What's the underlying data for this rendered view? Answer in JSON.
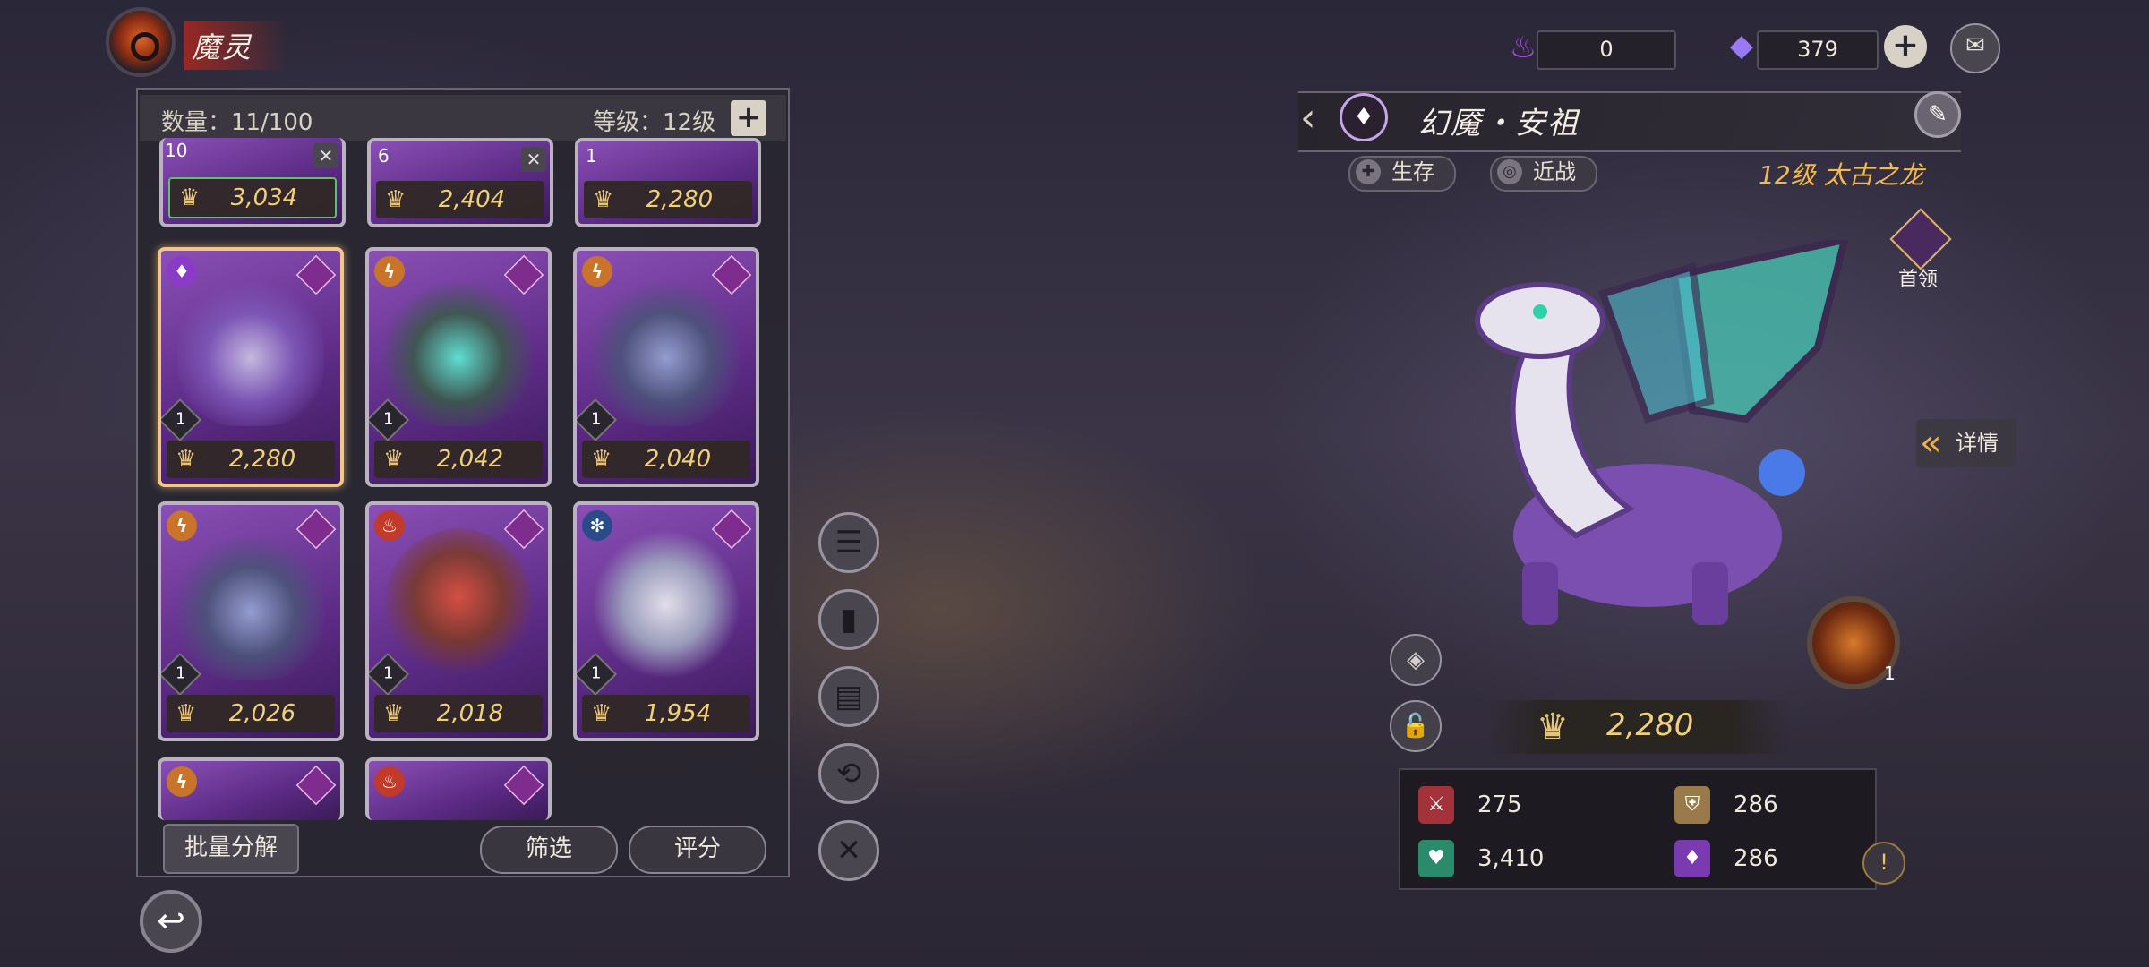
{
  "header": {
    "title": "魔灵"
  },
  "panel": {
    "count_label": "数量：11/100",
    "level_label": "等级：12级"
  },
  "cards_top": [
    {
      "level": "10",
      "power": "3,034",
      "has_crossed": true
    },
    {
      "level": "6",
      "power": "2,404",
      "has_crossed": true
    },
    {
      "level": "1",
      "power": "2,280",
      "has_crossed": false
    }
  ],
  "cards": [
    {
      "element": "water-drop",
      "level": "1",
      "power": "2,280",
      "selected": true,
      "color": "#9a7ad6"
    },
    {
      "element": "lightning",
      "level": "1",
      "power": "2,042",
      "color": "#4fd1c5"
    },
    {
      "element": "lightning",
      "level": "1",
      "power": "2,040",
      "color": "#6c7aa8"
    },
    {
      "element": "lightning",
      "level": "1",
      "power": "2,026",
      "color": "#6c7aa8"
    },
    {
      "element": "fire",
      "level": "1",
      "power": "2,018",
      "color": "#c2483a"
    },
    {
      "element": "snowflake",
      "level": "1",
      "power": "1,954",
      "color": "#d8dde8"
    }
  ],
  "bottom": {
    "batch_label": "批量分解",
    "filter_label": "筛选",
    "score_label": "评分"
  },
  "resources": {
    "energy": "0",
    "gems": "379"
  },
  "hero": {
    "name": "幻魇・安祖",
    "tag1": "生存",
    "tag2": "近战",
    "level_race": "12级  太古之龙",
    "leader_label": "首领",
    "details_label": "详情",
    "skill_level": "1",
    "power": "2,280",
    "stats": {
      "attack": "275",
      "defense": "286",
      "hp": "3,410",
      "magic_def": "286"
    }
  },
  "colors": {
    "accent_gold": "#f1d07c",
    "panel_bg": "#28262f",
    "card_purple": "#5b2a84"
  }
}
